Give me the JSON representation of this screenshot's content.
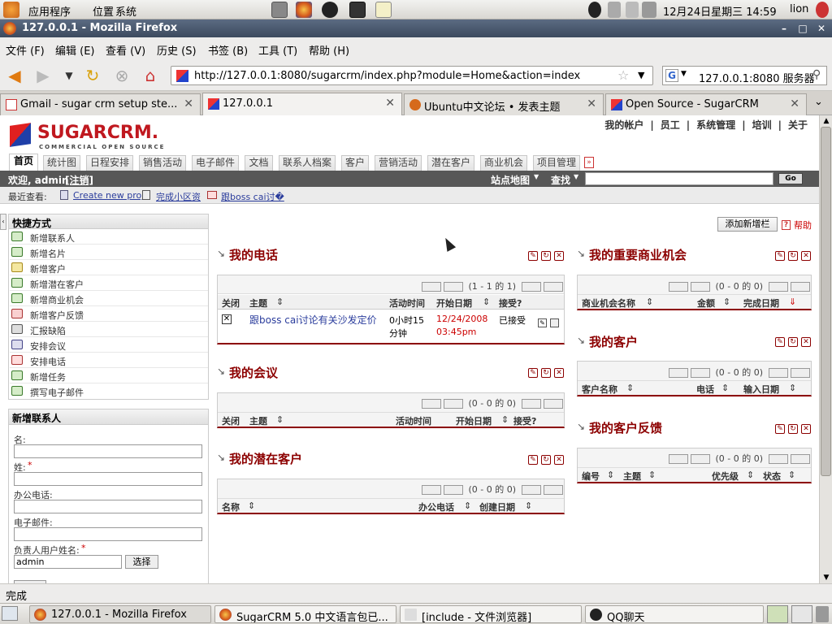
{
  "gnome_panel": {
    "apps": "应用程序",
    "places": "位置",
    "system": "系统",
    "clock": "12月24日星期三 14:59",
    "user": "lion"
  },
  "window": {
    "title": "127.0.0.1 - Mozilla Firefox"
  },
  "menu": {
    "file": "文件 (F)",
    "edit": "编辑 (E)",
    "view": "查看 (V)",
    "history": "历史 (S)",
    "bookmarks": "书签 (B)",
    "tools": "工具 (T)",
    "help": "帮助 (H)"
  },
  "nav": {
    "url": "http://127.0.0.1:8080/sugarcrm/index.php?module=Home&action=index",
    "search_value": "127.0.0.1:8080 服务器"
  },
  "tabs": [
    {
      "label": "Gmail - sugar crm setup ste..."
    },
    {
      "label": "127.0.0.1"
    },
    {
      "label": "Ubuntu中文论坛 • 发表主题"
    },
    {
      "label": "Open Source - SugarCRM"
    }
  ],
  "sugar": {
    "logo_main": "SUGARCRM.",
    "logo_sub": "COMMERCIAL OPEN SOURCE",
    "toplinks": [
      "我的帐户",
      "|",
      "员工",
      "|",
      "系统管理",
      "|",
      "培训",
      "|",
      "关于"
    ],
    "module_tabs": [
      "首页",
      "统计图",
      "日程安排",
      "销售活动",
      "电子邮件",
      "文档",
      "联系人档案",
      "客户",
      "营销活动",
      "潜在客户",
      "商业机会",
      "项目管理"
    ],
    "welcome": "欢迎, admin",
    "logout": "[注销]",
    "sitemap": "站点地图",
    "search_label": "查找",
    "go": "Go",
    "recent_label": "最近查看:",
    "recent": [
      "Create new proj",
      "完成小区资",
      "跟boss cai讨�"
    ],
    "shortcuts_title": "快捷方式",
    "shortcuts": [
      "新增联系人",
      "新增名片",
      "新增客户",
      "新增潜在客户",
      "新增商业机会",
      "新增客户反馈",
      "汇报缺陷",
      "安排会议",
      "安排电话",
      "新增任务",
      "撰写电子邮件"
    ],
    "quick_title": "新增联系人",
    "quick": {
      "first_name": "名:",
      "last_name": "姓:",
      "office_phone": "办公电话:",
      "email": "电子邮件:",
      "assigned": "负责人用户姓名:",
      "assigned_value": "admin",
      "select": "选择"
    },
    "add_dashlet": "添加新增栏",
    "help": "帮助",
    "dashlets": {
      "calls": {
        "title": "我的电话",
        "pager": "(1 - 1 的 1)",
        "cols": [
          "关闭",
          "主题",
          "活动时间",
          "开始日期",
          "接受?"
        ],
        "row": {
          "subject": "跟boss cai讨论有关沙发定价",
          "duration_1": "0小时15",
          "duration_2": "分钟",
          "date_1": "12/24/2008",
          "date_2": "03:45pm",
          "accept": "已接受"
        }
      },
      "meetings": {
        "title": "我的会议",
        "pager": "(0 - 0 的 0)",
        "cols": [
          "关闭",
          "主题",
          "活动时间",
          "开始日期",
          "接受?"
        ]
      },
      "leads": {
        "title": "我的潜在客户",
        "pager": "(0 - 0 的 0)",
        "cols": [
          "名称",
          "办公电话",
          "创建日期"
        ]
      },
      "opps": {
        "title": "我的重要商业机会",
        "pager": "(0 - 0 的 0)",
        "cols": [
          "商业机会名称",
          "金额",
          "完成日期"
        ]
      },
      "accounts": {
        "title": "我的客户",
        "pager": "(0 - 0 的 0)",
        "cols": [
          "客户名称",
          "电话",
          "输入日期"
        ]
      },
      "cases": {
        "title": "我的客户反馈",
        "pager": "(0 - 0 的 0)",
        "cols": [
          "编号",
          "主题",
          "优先级",
          "状态"
        ]
      }
    }
  },
  "status": "完成",
  "taskbar": [
    {
      "label": "127.0.0.1 - Mozilla Firefox"
    },
    {
      "label": "SugarCRM 5.0 中文语言包已..."
    },
    {
      "label": "[include - 文件浏览器]"
    },
    {
      "label": "QQ聊天"
    }
  ],
  "colors": {
    "brand_red": "#c0181f",
    "heading_red": "#8c0000",
    "link_blue": "#2a3c9c"
  }
}
